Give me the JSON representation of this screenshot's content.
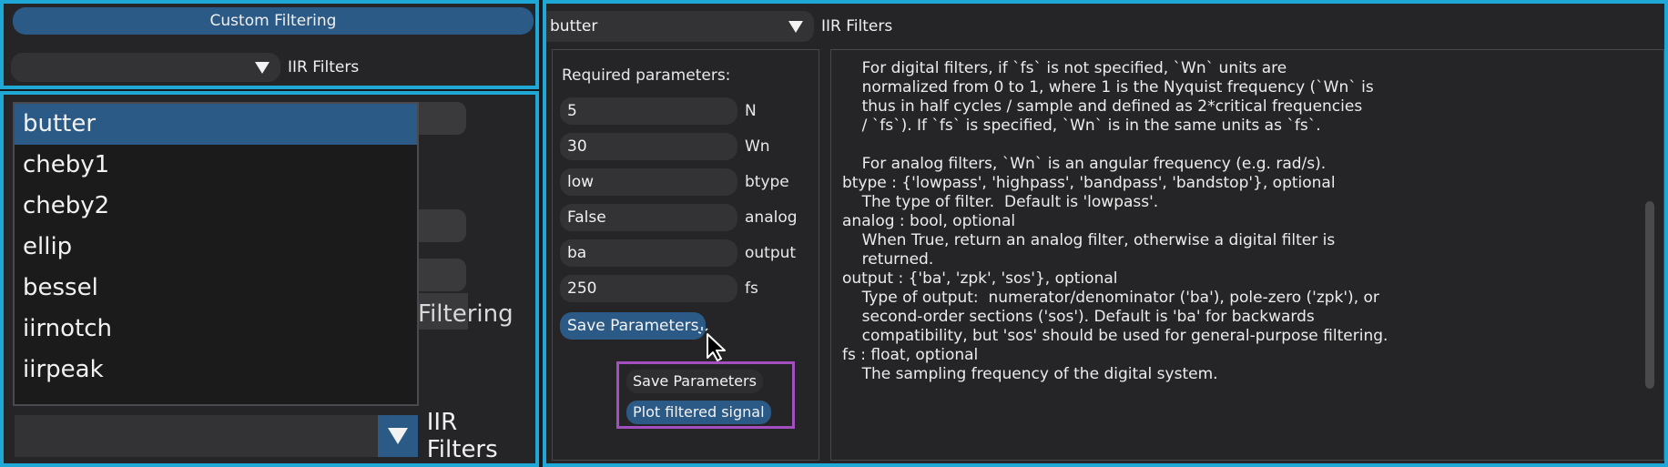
{
  "panel1": {
    "custom_filtering_button": "Custom Filtering",
    "combo_label": "IIR Filters"
  },
  "panel2": {
    "background_label": "Filtering",
    "dropdown_items": [
      "butter",
      "cheby1",
      "cheby2",
      "ellip",
      "bessel",
      "iirnotch",
      "iirpeak"
    ],
    "selected_item": "butter",
    "combo_label": "IIR Filters"
  },
  "panel3": {
    "combo_value": "butter",
    "combo_label": "IIR Filters",
    "required_title": "Required parameters:",
    "params": [
      {
        "value": "5",
        "name": "N"
      },
      {
        "value": "30",
        "name": "Wn"
      },
      {
        "value": "low",
        "name": "btype"
      },
      {
        "value": "False",
        "name": "analog"
      },
      {
        "value": "ba",
        "name": "output"
      },
      {
        "value": "250",
        "name": "fs"
      }
    ],
    "save_button": "Save Parameters",
    "popup": {
      "save_parameters": "Save Parameters",
      "plot_filtered_signal": "Plot filtered signal"
    },
    "doc_lines": [
      "    For digital filters, if `fs` is not specified, `Wn` units are",
      "    normalized from 0 to 1, where 1 is the Nyquist frequency (`Wn` is",
      "    thus in half cycles / sample and defined as 2*critical frequencies",
      "    / `fs`). If `fs` is specified, `Wn` is in the same units as `fs`.",
      "",
      "    For analog filters, `Wn` is an angular frequency (e.g. rad/s).",
      "btype : {'lowpass', 'highpass', 'bandpass', 'bandstop'}, optional",
      "    The type of filter.  Default is 'lowpass'.",
      "analog : bool, optional",
      "    When True, return an analog filter, otherwise a digital filter is",
      "    returned.",
      "output : {'ba', 'zpk', 'sos'}, optional",
      "    Type of output:  numerator/denominator ('ba'), pole-zero ('zpk'), or",
      "    second-order sections ('sos'). Default is 'ba' for backwards",
      "    compatibility, but 'sos' should be used for general-purpose filtering.",
      "fs : float, optional",
      "    The sampling frequency of the digital system."
    ]
  },
  "colors": {
    "border_accent": "#1fa7d6",
    "button_blue": "#2c5a86",
    "popup_border": "#a44fc0",
    "panel_bg": "#252527"
  }
}
